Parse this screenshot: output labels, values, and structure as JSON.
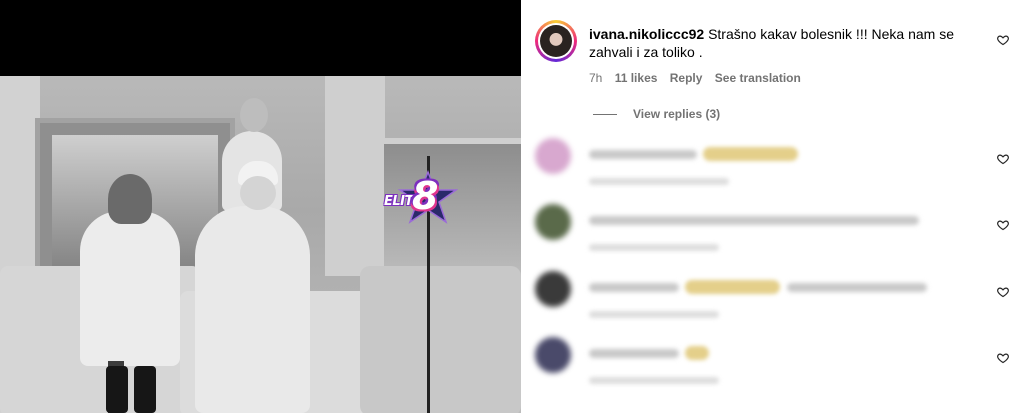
{
  "video": {
    "logo_text": "ELITA",
    "logo_number": "8"
  },
  "top_comment": {
    "username": "ivana.nikoliccc92",
    "text": "Strašno kakav bolesnik !!! Neka nam se zahvali i za toliko .",
    "time": "7h",
    "likes": "11 likes",
    "reply_label": "Reply",
    "translation_label": "See translation",
    "view_replies_label": "View replies (3)"
  },
  "replies": [
    {
      "avatar_color": "#d8a8cf",
      "blurred": true
    },
    {
      "avatar_color": "#5a6a4a",
      "blurred": true
    },
    {
      "avatar_color": "#3a3a3a",
      "blurred": true
    },
    {
      "avatar_color": "#4a4a6a",
      "blurred": true
    }
  ],
  "icons": {
    "like": "heart-outline-icon"
  },
  "colors": {
    "meta_text": "#737373",
    "video_bg": "#000000"
  }
}
